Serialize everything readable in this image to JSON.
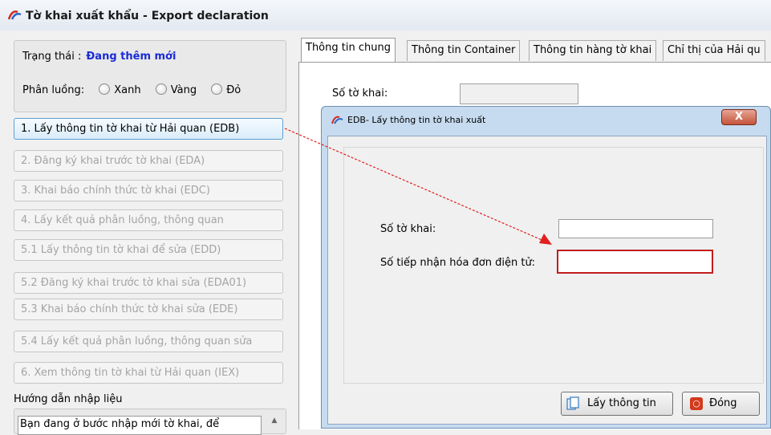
{
  "window": {
    "title": "Tờ khai xuất khẩu - Export declaration"
  },
  "status": {
    "label": "Trạng thái :",
    "value": "Đang thêm mới"
  },
  "routing": {
    "label": "Phân luồng:",
    "options": [
      "Xanh",
      "Vàng",
      "Đỏ"
    ]
  },
  "steps": [
    "1. Lấy thông tin tờ khai từ Hải quan (EDB)",
    "2. Đăng ký khai trước tờ khai (EDA)",
    "3. Khai báo chính thức tờ khai (EDC)",
    "4. Lấy kết quả phân luồng, thông quan",
    "5.1 Lấy thông tin tờ khai để sửa (EDD)",
    "5.2 Đăng ký khai trước tờ khai sửa (EDA01)",
    "5.3 Khai báo chính thức tờ khai sửa (EDE)",
    "5.4 Lấy kết quả phân luồng, thông quan sửa",
    "6. Xem thông tin tờ khai từ Hải quan (IEX)"
  ],
  "guide": {
    "title": "Hướng dẫn nhập liệu",
    "text": "Bạn đang ở bước nhập mới tờ khai, để"
  },
  "tabs": [
    "Thông tin chung",
    "Thông tin Container",
    "Thông tin hàng tờ khai",
    "Chỉ thị của Hải qu"
  ],
  "main": {
    "declaration_no_label": "Số tờ khai:"
  },
  "dialog": {
    "title": "EDB- Lấy thông tin tờ khai xuất",
    "close_label": "X",
    "field1_label": "Số tờ khai:",
    "field1_value": "",
    "field2_label": "Số tiếp nhận hóa đơn điện tử:",
    "field2_value": "",
    "get_info_label": "Lấy thông tin",
    "close_button_label": "Đóng"
  },
  "colors": {
    "status_value": "#1a2bd6",
    "highlight": "#c21c1c",
    "arrow": "#e02020"
  }
}
